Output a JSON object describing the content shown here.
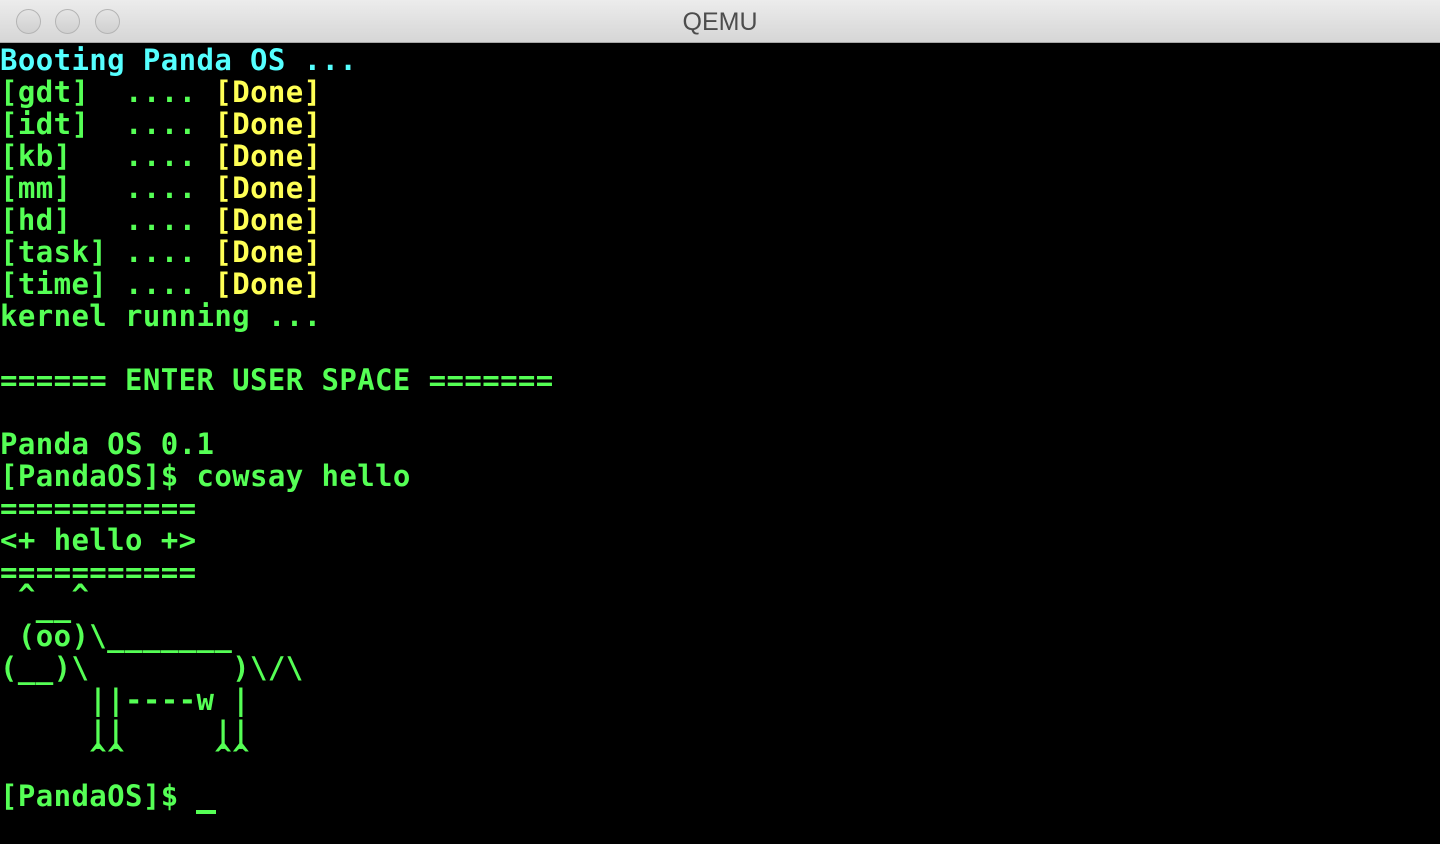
{
  "window": {
    "title": "QEMU"
  },
  "colors": {
    "boot_header": "#55ffff",
    "module_name": "#55ff55",
    "status_done": "#ffff55",
    "text": "#55ff55"
  },
  "boot": {
    "header": "Booting Panda OS ...",
    "modules": [
      {
        "name": "[gdt]  ",
        "dots": ".... ",
        "status": "[Done]"
      },
      {
        "name": "[idt]  ",
        "dots": ".... ",
        "status": "[Done]"
      },
      {
        "name": "[kb]   ",
        "dots": ".... ",
        "status": "[Done]"
      },
      {
        "name": "[mm]   ",
        "dots": ".... ",
        "status": "[Done]"
      },
      {
        "name": "[hd]   ",
        "dots": ".... ",
        "status": "[Done]"
      },
      {
        "name": "[task] ",
        "dots": ".... ",
        "status": "[Done]"
      },
      {
        "name": "[time] ",
        "dots": ".... ",
        "status": "[Done]"
      }
    ],
    "kernel_status": "kernel running ..."
  },
  "userspace": {
    "banner": "====== ENTER USER SPACE =======",
    "version": "Panda OS 0.1",
    "command_prompt": "[PandaOS]$ cowsay hello",
    "cowsay_lines": [
      "===========",
      "<+ hello +>",
      "===========",
      " ^  ^",
      "  __",
      " (oo)\\_______",
      "(__)\\        )\\/\\",
      "     ||----w |",
      "     ||     ||",
      "     ^^     ^^"
    ],
    "final_prompt": "[PandaOS]$ "
  }
}
